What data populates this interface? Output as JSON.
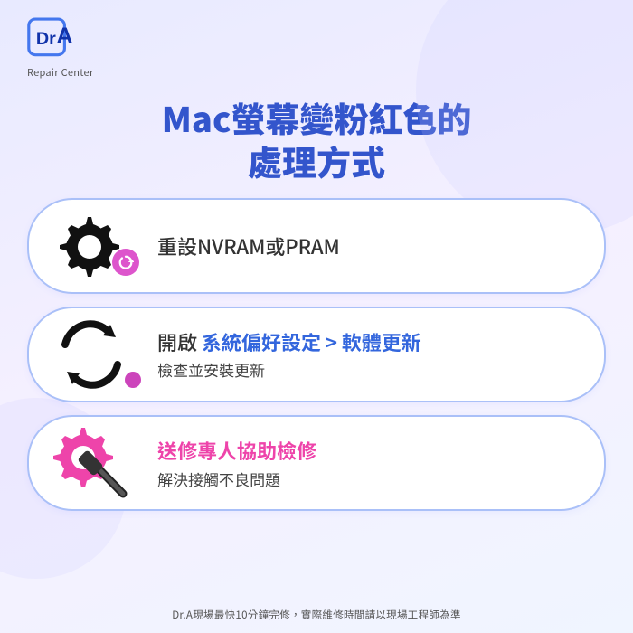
{
  "logo": {
    "text": "Repair Center",
    "brand": "Dr.A"
  },
  "title": {
    "line1": "Mac螢幕變粉紅色的",
    "line2": "處理方式"
  },
  "cards": [
    {
      "id": "nvram",
      "text_main": "重設NVRAM或PRAM",
      "text_sub": null,
      "icon_type": "gear-reset"
    },
    {
      "id": "update",
      "text_prefix": "開啟 ",
      "text_highlight": "系統偏好設定 > 軟體更新",
      "text_sub": "檢查並安裝更新",
      "icon_type": "update-arrows"
    },
    {
      "id": "repair",
      "text_main": "送修專人協助檢修",
      "text_sub": "解決接觸不良問題",
      "icon_type": "pink-gear-wrench"
    }
  ],
  "footer": "Dr.A現場最快10分鐘完修，實際維修時間請以現場工程師為準",
  "colors": {
    "title_blue": "#3355cc",
    "border_blue": "#aac0f8",
    "highlight_blue": "#3366dd",
    "highlight_pink": "#ee44aa",
    "gear_pink": "#ee55bb"
  }
}
